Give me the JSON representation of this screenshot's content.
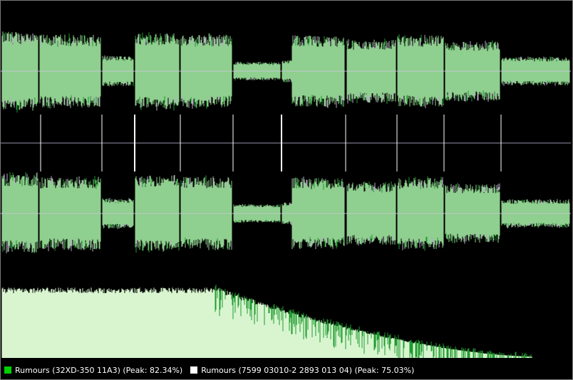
{
  "colors": {
    "background": "#000000",
    "wave_fill": "#8fcf8f",
    "wave_dark": "#1f9a2f",
    "wave_outline": "#b8a8c8",
    "center_line": "#c8c8d8",
    "track_marker": "#ffffff",
    "spectrum_fill": "#d8f5d0",
    "spectrum_dark": "#1f9a2f",
    "legend_text": "#ffffff"
  },
  "legend": [
    {
      "label": "Rumours (32XD-350 11A3) (Peak: 82.34%)",
      "color": "#00d000"
    },
    {
      "label": "Rumours (7599 03010-2 2893 013 04) (Peak: 75.03%)",
      "color": "#ffffff"
    }
  ]
}
